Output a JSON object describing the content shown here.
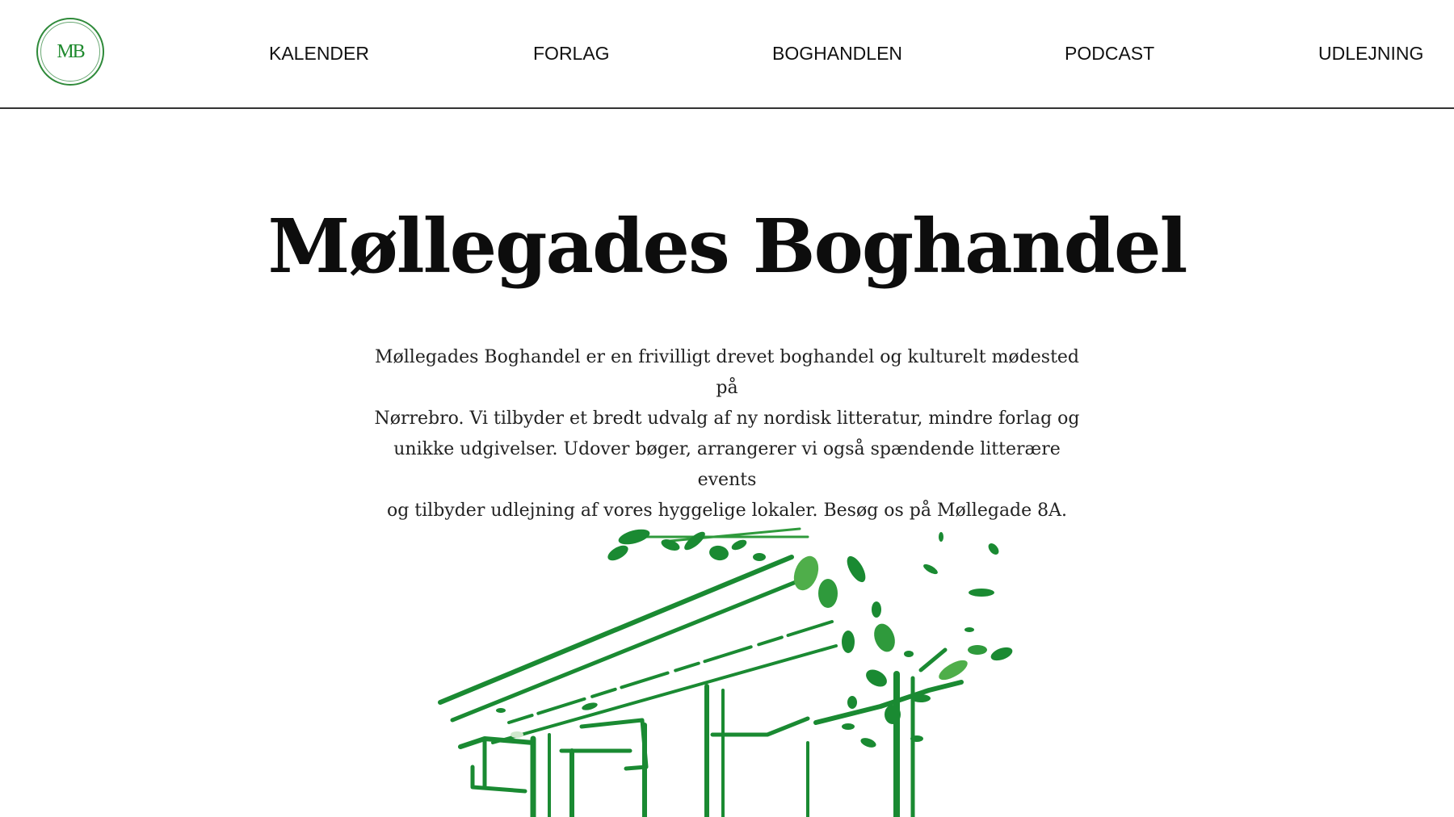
{
  "header": {
    "logo_text": "MB",
    "nav": [
      {
        "label": "KALENDER"
      },
      {
        "label": "FORLAG"
      },
      {
        "label": "BOGHANDLEN"
      },
      {
        "label": "PODCAST"
      },
      {
        "label": "UDLEJNING"
      }
    ]
  },
  "main": {
    "title": "Møllegades Boghandel",
    "intro_lines": [
      "Møllegades Boghandel er en frivilligt drevet boghandel og kulturelt mødested på",
      "Nørrebro. Vi tilbyder et bredt udvalg af ny nordisk litteratur, mindre forlag og",
      "unikke udgivelser. Udover bøger, arrangerer vi også spændende litterære events",
      "og tilbyder udlejning af vores hyggelige lokaler. Besøg os på Møllegade 8A."
    ],
    "illustration_icon": "bookshop-storefront-drawing"
  },
  "colors": {
    "brand_green": "#1f8a2e",
    "illustration_green": "#1a8a32",
    "illustration_light_green": "#4fae4a",
    "text": "#111111",
    "divider": "#333333"
  }
}
